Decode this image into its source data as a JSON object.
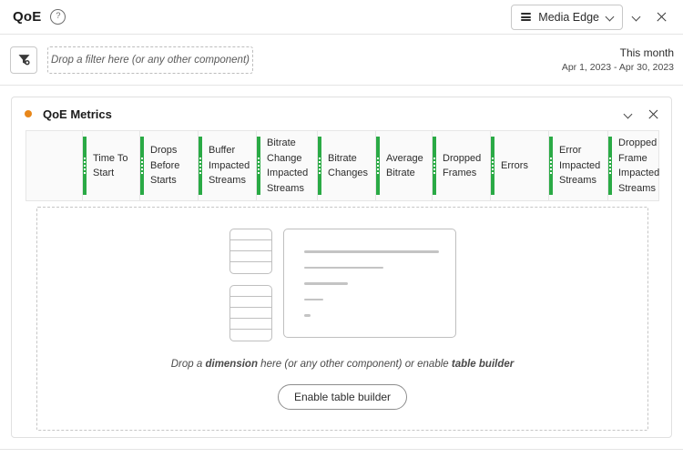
{
  "topbar": {
    "title": "QoE",
    "help_icon": "help-circle-icon",
    "help_glyph": "?",
    "data_view": {
      "icon": "data-stack-icon",
      "label": "Media Edge"
    },
    "collapse_icon": "chevron-down-icon",
    "close_icon": "close-icon"
  },
  "filterbar": {
    "filter_icon": "filter-funnel-icon",
    "dropzone_placeholder": "Drop a filter here (or any other component)",
    "daterange": {
      "label": "This month",
      "range": "Apr 1, 2023 - Apr 30, 2023"
    }
  },
  "panel": {
    "status_dot_color": "#e8871a",
    "title": "QoE Metrics",
    "collapse_icon": "chevron-down-icon",
    "close_icon": "close-icon",
    "metrics": [
      "",
      "Time To Start",
      "Drops Before Starts",
      "Buffer Impacted Streams",
      "Bitrate Change Impacted Streams",
      "Bitrate Changes",
      "Average Bitrate",
      "Dropped Frames",
      "Errors",
      "Error Impacted Streams",
      "Dropped Frame Impacted Streams"
    ],
    "metric_accent_color": "#2aaa45",
    "dropzone": {
      "placeholder_art": "freeform-table-placeholder-icon",
      "hint_part1": "Drop a ",
      "hint_bold1": "dimension",
      "hint_part2": " here (or any other component) or enable ",
      "hint_bold2": "table builder",
      "button_label": "Enable table builder"
    }
  }
}
